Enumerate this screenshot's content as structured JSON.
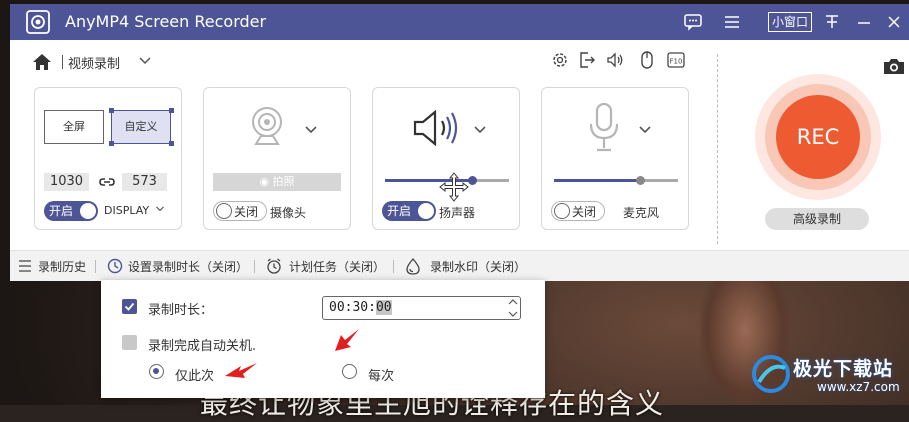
{
  "window": {
    "title": "AnyMP4 Screen Recorder",
    "mini_window_label": "小窗口"
  },
  "toolbar": {
    "mode_label": "视频录制",
    "icons": [
      "settings-icon",
      "export-icon",
      "speaker-icon",
      "mouse-icon",
      "f10-hotkey-icon"
    ]
  },
  "screen_card": {
    "full_label": "全屏",
    "custom_label": "自定义",
    "width": "1030",
    "height": "573",
    "toggle_label": "开启",
    "display_label": "DISPLAY"
  },
  "camera_card": {
    "snapshot_label": "拍照",
    "toggle_label": "关闭",
    "device_label": "摄像头"
  },
  "speaker_card": {
    "toggle_label": "开启",
    "device_label": "扬声器",
    "volume": 0.7
  },
  "mic_card": {
    "toggle_label": "关闭",
    "device_label": "麦克风",
    "volume": 0.69
  },
  "rec": {
    "label": "REC",
    "advanced_label": "高级录制"
  },
  "bottombar": {
    "history": "录制历史",
    "duration": "设置录制时长（关闭）",
    "schedule": "计划任务（关闭）",
    "watermark": "录制水印（关闭）"
  },
  "popup": {
    "duration_label": "录制时长：",
    "duration_value_prefix": "00:30:",
    "duration_value_selected": "00",
    "shutdown_label": "录制完成自动关机.",
    "option_once": "仅此次",
    "option_every": "每次"
  },
  "background": {
    "subtitle": "最终让物象里主旭的诠释存在的含义",
    "watermark_text": "极光下载站",
    "watermark_url": "www.xz7.com"
  },
  "colors": {
    "accent": "#4e5597",
    "rec": "#ee5a32",
    "arrow": "#e02020"
  }
}
